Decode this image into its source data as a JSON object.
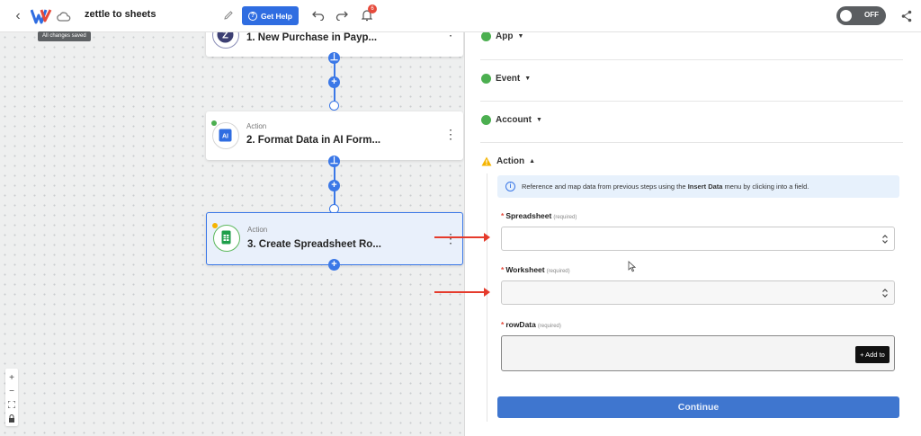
{
  "header": {
    "back_icon": "chevron-left-icon",
    "logo": "make-logo",
    "save_tooltip": "All changes saved",
    "workflow_title": "zettle to sheets",
    "help_label": "Get Help",
    "notification_count": "6",
    "toggle_label": "OFF"
  },
  "canvas": {
    "nodes": [
      {
        "label": "",
        "title": "1. New Purchase in Payp..."
      },
      {
        "label": "Action",
        "title": "2. Format Data in AI Form..."
      },
      {
        "label": "Action",
        "title": "3. Create Spreadsheet Ro..."
      }
    ]
  },
  "panel": {
    "sections": {
      "app": "App",
      "event": "Event",
      "account": "Account",
      "action": "Action"
    },
    "info": {
      "before": "Reference and map data from previous steps using the ",
      "bold": "Insert Data",
      "after": " menu by clicking into a field."
    },
    "fields": {
      "spreadsheet": {
        "label": "Spreadsheet",
        "required": "(required)",
        "value": ""
      },
      "worksheet": {
        "label": "Worksheet",
        "required": "(required)",
        "value": ""
      },
      "rowdata": {
        "label": "rowData",
        "required": "(required)",
        "value": ""
      }
    },
    "add_to_label": "+ Add to",
    "continue_label": "Continue"
  },
  "colors": {
    "primary": "#2f6de1",
    "selected_border": "#3b78e7",
    "success": "#4caf50",
    "warning": "#f5b400",
    "annotation": "#e53b2c"
  }
}
